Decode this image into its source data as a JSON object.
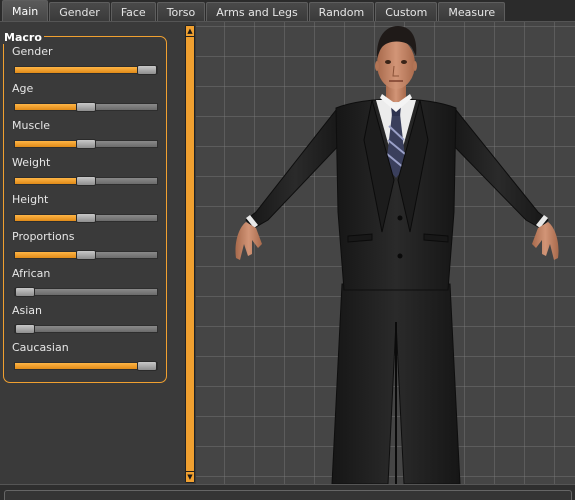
{
  "tabs": [
    {
      "label": "Main",
      "active": true
    },
    {
      "label": "Gender",
      "active": false
    },
    {
      "label": "Face",
      "active": false
    },
    {
      "label": "Torso",
      "active": false
    },
    {
      "label": "Arms and Legs",
      "active": false
    },
    {
      "label": "Random",
      "active": false
    },
    {
      "label": "Custom",
      "active": false
    },
    {
      "label": "Measure",
      "active": false
    }
  ],
  "macro": {
    "title": "Macro",
    "sliders": [
      {
        "label": "Gender",
        "value": 0.93
      },
      {
        "label": "Age",
        "value": 0.5
      },
      {
        "label": "Muscle",
        "value": 0.5
      },
      {
        "label": "Weight",
        "value": 0.5
      },
      {
        "label": "Height",
        "value": 0.5
      },
      {
        "label": "Proportions",
        "value": 0.5
      },
      {
        "label": "African",
        "value": 0.07
      },
      {
        "label": "Asian",
        "value": 0.07
      },
      {
        "label": "Caucasian",
        "value": 0.93
      }
    ]
  },
  "colors": {
    "accent": "#f0a030",
    "panel_bg": "#3a3a3a",
    "viewport_bg": "#454545",
    "suit": "#222222",
    "skin": "#c98a6a"
  },
  "icons": {
    "scroll_up": "▲",
    "scroll_down": "▼"
  }
}
